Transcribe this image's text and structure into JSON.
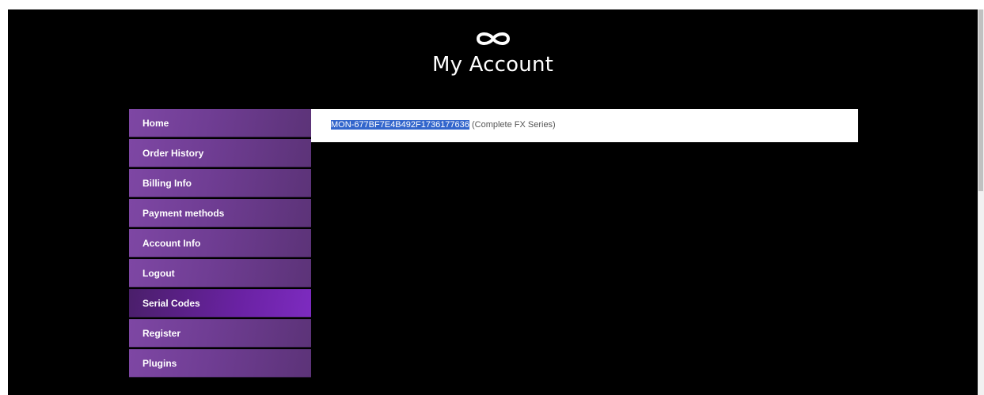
{
  "header": {
    "logo_icon": "infinity-icon",
    "title": "My Account"
  },
  "sidebar": {
    "items": [
      {
        "label": "Home",
        "active": false
      },
      {
        "label": "Order History",
        "active": false
      },
      {
        "label": "Billing Info",
        "active": false
      },
      {
        "label": "Payment methods",
        "active": false
      },
      {
        "label": "Account Info",
        "active": false
      },
      {
        "label": "Logout",
        "active": false
      },
      {
        "label": "Serial Codes",
        "active": true
      },
      {
        "label": "Register",
        "active": false
      },
      {
        "label": "Plugins",
        "active": false
      }
    ]
  },
  "serial_codes": {
    "code": "MON-677BF7E4B492F1736177636",
    "product": "(Complete FX Series)"
  },
  "colors": {
    "page_bg": "#000000",
    "nav_bg": "#7e47a4",
    "nav_active_bg": "#6a22a3",
    "selection": "#3366cc"
  }
}
